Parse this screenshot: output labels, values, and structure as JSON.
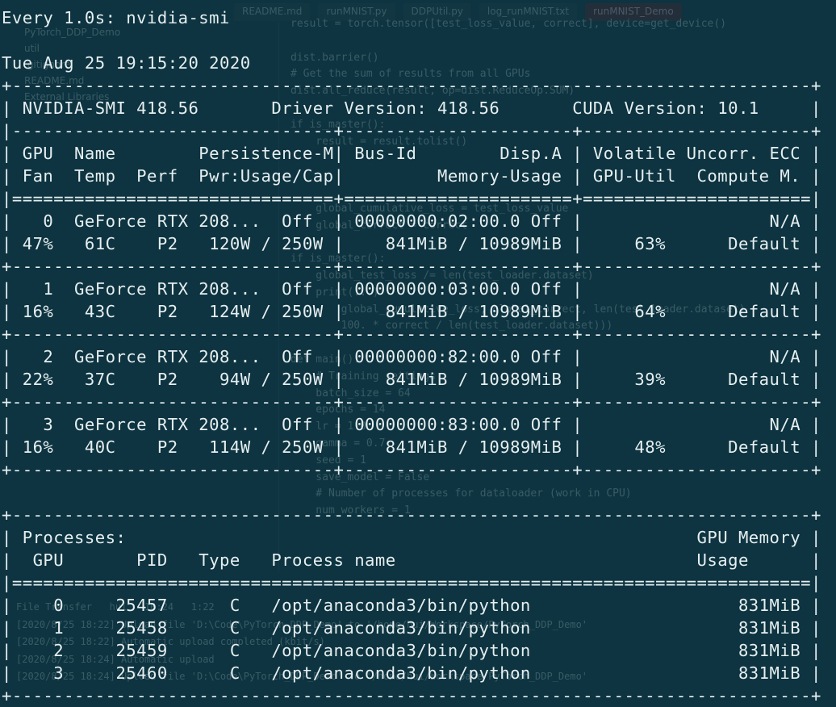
{
  "terminal": {
    "lines": [
      "Every 1.0s: nvidia-smi",
      "",
      "Tue Aug 25 19:15:20 2020",
      "+-----------------------------------------------------------------------------+",
      "| NVIDIA-SMI 418.56       Driver Version: 418.56       CUDA Version: 10.1     |",
      "|-------------------------------+----------------------+----------------------+",
      "| GPU  Name        Persistence-M| Bus-Id        Disp.A | Volatile Uncorr. ECC |",
      "| Fan  Temp  Perf  Pwr:Usage/Cap|         Memory-Usage | GPU-Util  Compute M. |",
      "|===============================+======================+======================|",
      "|   0  GeForce RTX 208...  Off  | 00000000:02:00.0 Off |                  N/A |",
      "| 47%   61C    P2   120W / 250W |    841MiB / 10989MiB |     63%      Default |",
      "+-------------------------------+----------------------+----------------------+",
      "|   1  GeForce RTX 208...  Off  | 00000000:03:00.0 Off |                  N/A |",
      "| 16%   43C    P2   124W / 250W |    841MiB / 10989MiB |     64%      Default |",
      "+-------------------------------+----------------------+----------------------+",
      "|   2  GeForce RTX 208...  Off  | 00000000:82:00.0 Off |                  N/A |",
      "| 22%   37C    P2    94W / 250W |    841MiB / 10989MiB |     39%      Default |",
      "+-------------------------------+----------------------+----------------------+",
      "|   3  GeForce RTX 208...  Off  | 00000000:83:00.0 Off |                  N/A |",
      "| 16%   40C    P2   114W / 250W |    841MiB / 10989MiB |     48%      Default |",
      "+-------------------------------+----------------------+----------------------+",
      "",
      "+-----------------------------------------------------------------------------+",
      "| Processes:                                                       GPU Memory |",
      "|  GPU       PID   Type   Process name                             Usage      |",
      "|=============================================================================|",
      "|    0     25457      C   /opt/anaconda3/bin/python                    831MiB |",
      "|    1     25458      C   /opt/anaconda3/bin/python                    831MiB |",
      "|    2     25459      C   /opt/anaconda3/bin/python                    831MiB |",
      "|    3     25460      C   /opt/anaconda3/bin/python                    831MiB |",
      "+-----------------------------------------------------------------------------+"
    ]
  },
  "background_ide": {
    "tabs": [
      "README.md",
      "runMNIST.py",
      "DDPUtil.py",
      "log_runMNIST.txt",
      "runMNIST_Demo"
    ],
    "tree": [
      "PyTorch_DDP_Demo",
      "util",
      ".gitignore",
      "README.md",
      "External Libraries"
    ],
    "code_lines": [
      "result = torch.tensor([test_loss_value, correct], device=get_device()",
      "",
      "dist.barrier()",
      "# Get the sum of results from all GPUs",
      "dist.all_reduce(result, op=dist.ReduceOp.SUM)",
      "",
      "if is_master():",
      "    result = result.tolist()",
      "",
      "",
      "",
      "    global_cumulative_loss = test_loss_value",
      "    global_correct = correct",
      "",
      "if is_master():",
      "    global_test_loss /= len(test_loader.dataset)",
      "    print(...)",
      "        global_cumulative_loss, global_correct, len(test_loader.dataset)",
      "        100. * correct / len(test_loader.dataset)))",
      "",
      "def main():",
      "    # Training settings",
      "    batch_size = 64",
      "    epochs = 14",
      "    lr = 1.0",
      "    gamma = 0.7",
      "    seed = 1",
      "    save_model = False",
      "    # Number of processes for dataloader (work in CPU)",
      "    num_workers = 1"
    ],
    "log_lines": [
      "File Transfer   hui   10:24   1:22",
      "[2020/8/25 18:22] Upload file 'D:\\Code\\PyTorch_DDP_Demo' to '/home/hui/Workspace/PyTorch_DDP_Demo'",
      "[2020/8/25 18:22] Automatic upload completed (kbit/s)",
      "[2020/8/25 18:24] Automatic upload",
      "[2020/8/25 18:24] Upload file 'D:\\Code\\PyTorch_DDP_Demo' to '/home/hui/Workspace/PyTorch_DDP_Demo'"
    ]
  }
}
